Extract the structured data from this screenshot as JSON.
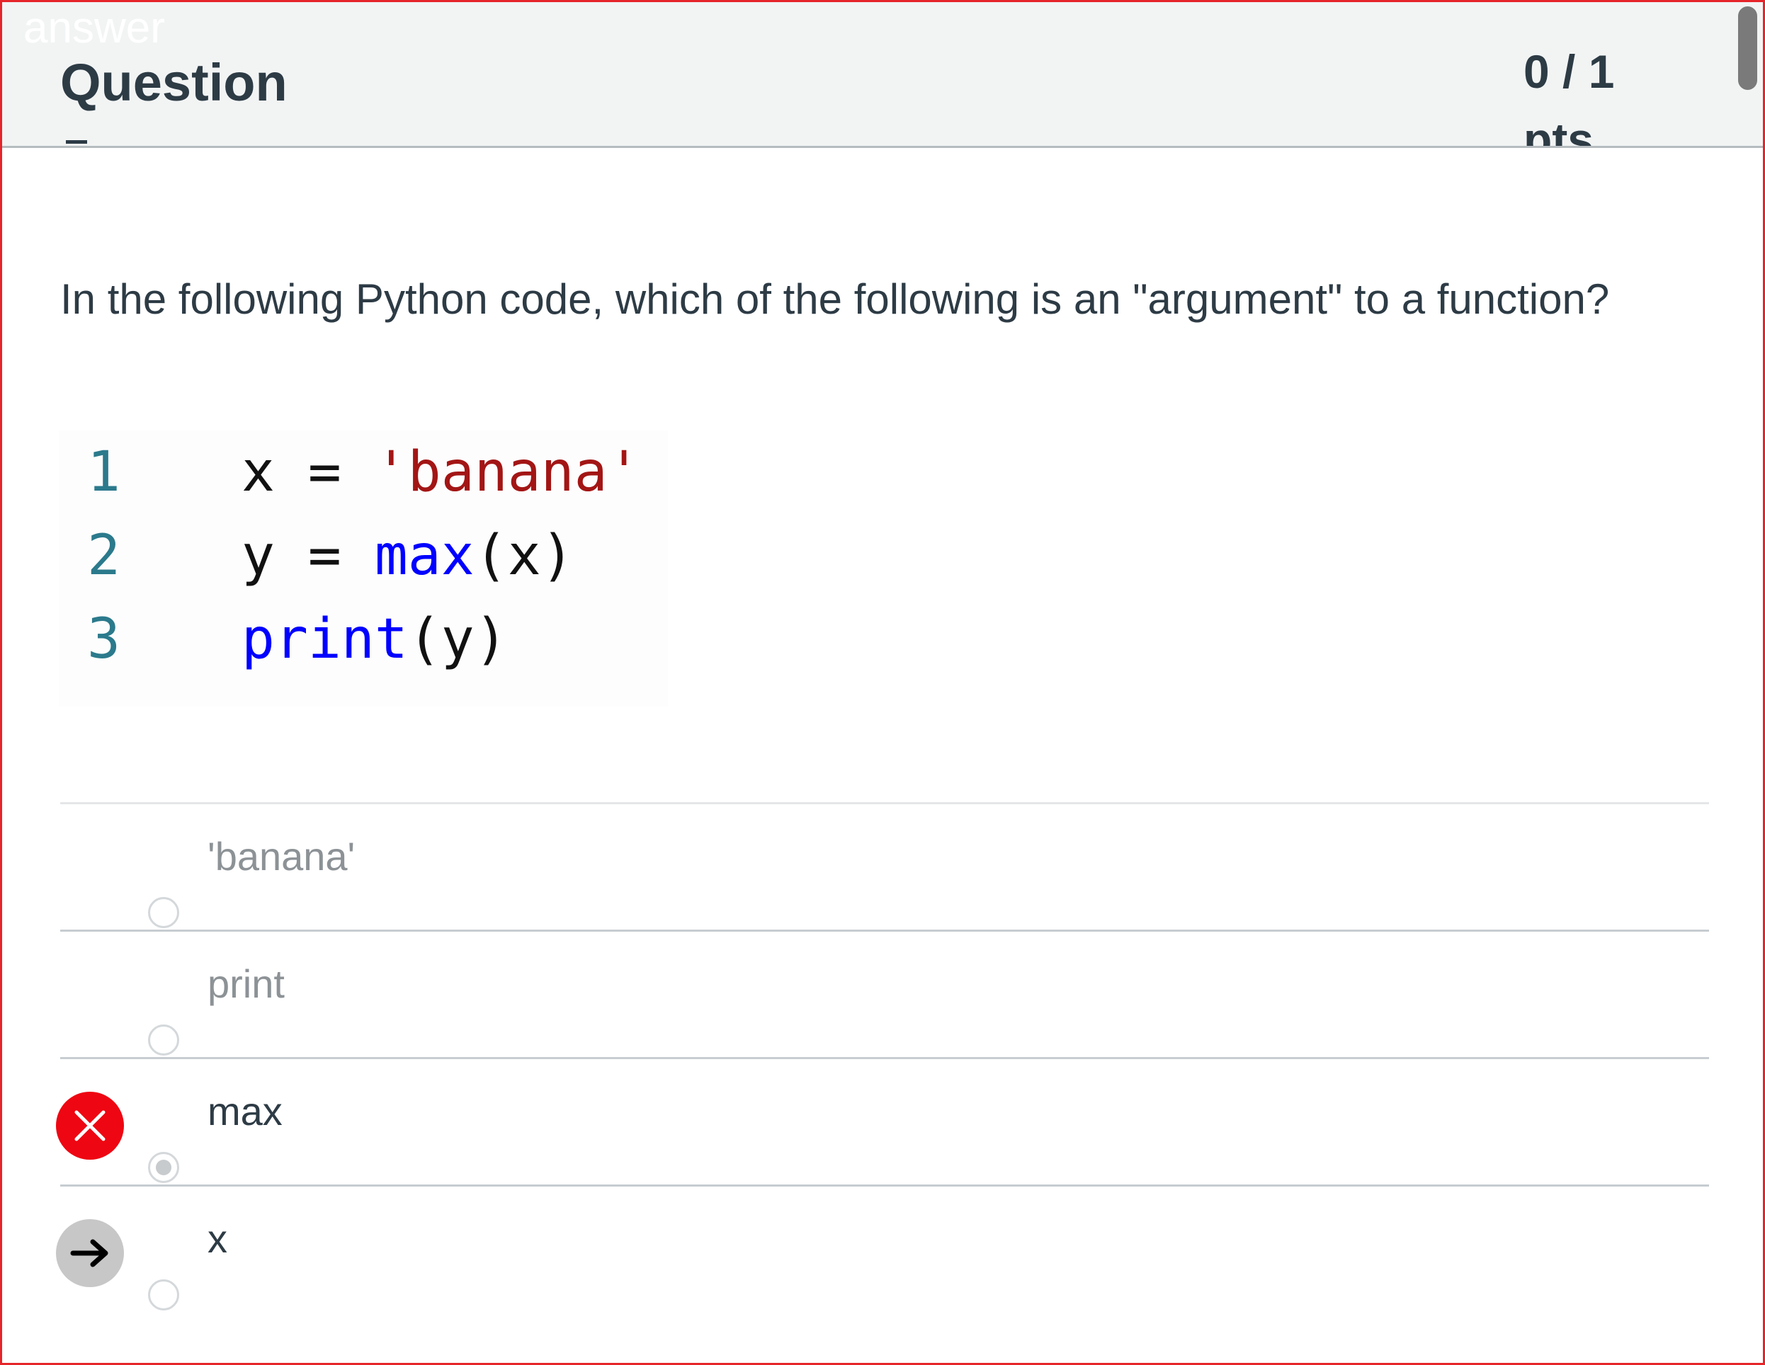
{
  "header": {
    "ghost_label": "answer",
    "title": "Question",
    "points": "0 / 1 pts"
  },
  "question": {
    "text": "In the following Python code, which of the following is an \"argument\" to a function?"
  },
  "code": {
    "lines": [
      {
        "num": "1",
        "tokens": [
          {
            "t": "x = ",
            "k": "plain"
          },
          {
            "t": "'banana'",
            "k": "str"
          }
        ]
      },
      {
        "num": "2",
        "tokens": [
          {
            "t": "y = ",
            "k": "plain"
          },
          {
            "t": "max",
            "k": "fn"
          },
          {
            "t": "(x)",
            "k": "plain"
          }
        ]
      },
      {
        "num": "3",
        "tokens": [
          {
            "t": "print",
            "k": "fn"
          },
          {
            "t": "(y)",
            "k": "plain"
          }
        ]
      }
    ]
  },
  "answers": [
    {
      "label": "'banana'",
      "selected": false,
      "status": "none"
    },
    {
      "label": "print",
      "selected": false,
      "status": "none"
    },
    {
      "label": "max",
      "selected": true,
      "status": "wrong"
    },
    {
      "label": "x",
      "selected": false,
      "status": "correct"
    }
  ],
  "colors": {
    "wrong": "#ee0612",
    "correct_marker": "#c7c7c7",
    "frame_border": "#e5252a",
    "code_string": "#a31515",
    "code_function": "#0000ff",
    "line_number": "#2b7a8c"
  }
}
